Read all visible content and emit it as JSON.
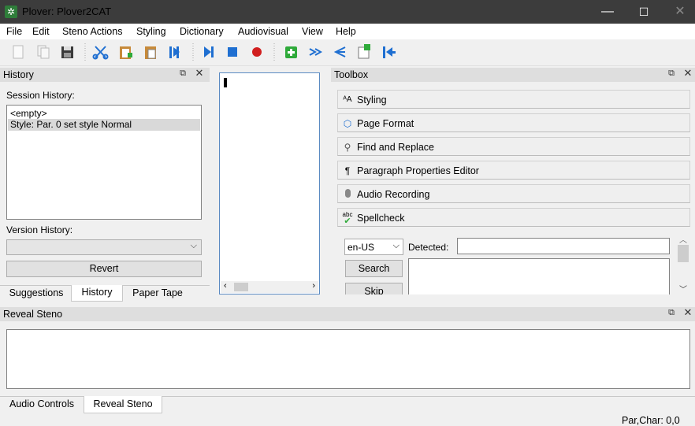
{
  "window": {
    "title": "Plover: Plover2CAT",
    "minimize": "—",
    "maximize": "☐",
    "close": "✕"
  },
  "menu": [
    "File",
    "Edit",
    "Steno Actions",
    "Styling",
    "Dictionary",
    "Audiovisual",
    "View",
    "Help"
  ],
  "toolbar": {
    "icons": [
      "new-file-icon",
      "copy-icon",
      "save-icon",
      "cut-icon",
      "paste-icon",
      "clipboard-icon",
      "split-icon",
      "play-icon",
      "stop-icon",
      "record-icon",
      "add-icon",
      "jump-icon",
      "share-icon",
      "insert-icon",
      "first-icon"
    ]
  },
  "history_panel": {
    "title": "History",
    "session_label": "Session History:",
    "session_items": [
      "<empty>",
      "Style: Par. 0 set style Normal"
    ],
    "version_label": "Version History:",
    "version_value": "",
    "revert_label": "Revert",
    "tabs": [
      "Suggestions",
      "History",
      "Paper Tape"
    ],
    "active_tab": "History"
  },
  "toolbox": {
    "title": "Toolbox",
    "buttons": [
      {
        "label": "Styling",
        "icon": "styling-icon"
      },
      {
        "label": "Page Format",
        "icon": "page-format-icon"
      },
      {
        "label": "Find and Replace",
        "icon": "find-icon"
      },
      {
        "label": "Paragraph Properties Editor",
        "icon": "paragraph-icon"
      },
      {
        "label": "Audio Recording",
        "icon": "microphone-icon"
      },
      {
        "label": "Spellcheck",
        "icon": "spellcheck-icon"
      }
    ],
    "spellcheck": {
      "locale": "en-US",
      "detected_label": "Detected:",
      "search_label": "Search",
      "skip_label": "Skip"
    }
  },
  "reveal_panel": {
    "title": "Reveal Steno",
    "tabs": [
      "Audio Controls",
      "Reveal Steno"
    ],
    "active_tab": "Reveal Steno"
  },
  "status": {
    "text": "Par,Char: 0,0"
  },
  "colors": {
    "titlebar": "#3c3c3c",
    "play": "#1f6fd1",
    "record": "#d11f1f",
    "add": "#2faa3a"
  }
}
